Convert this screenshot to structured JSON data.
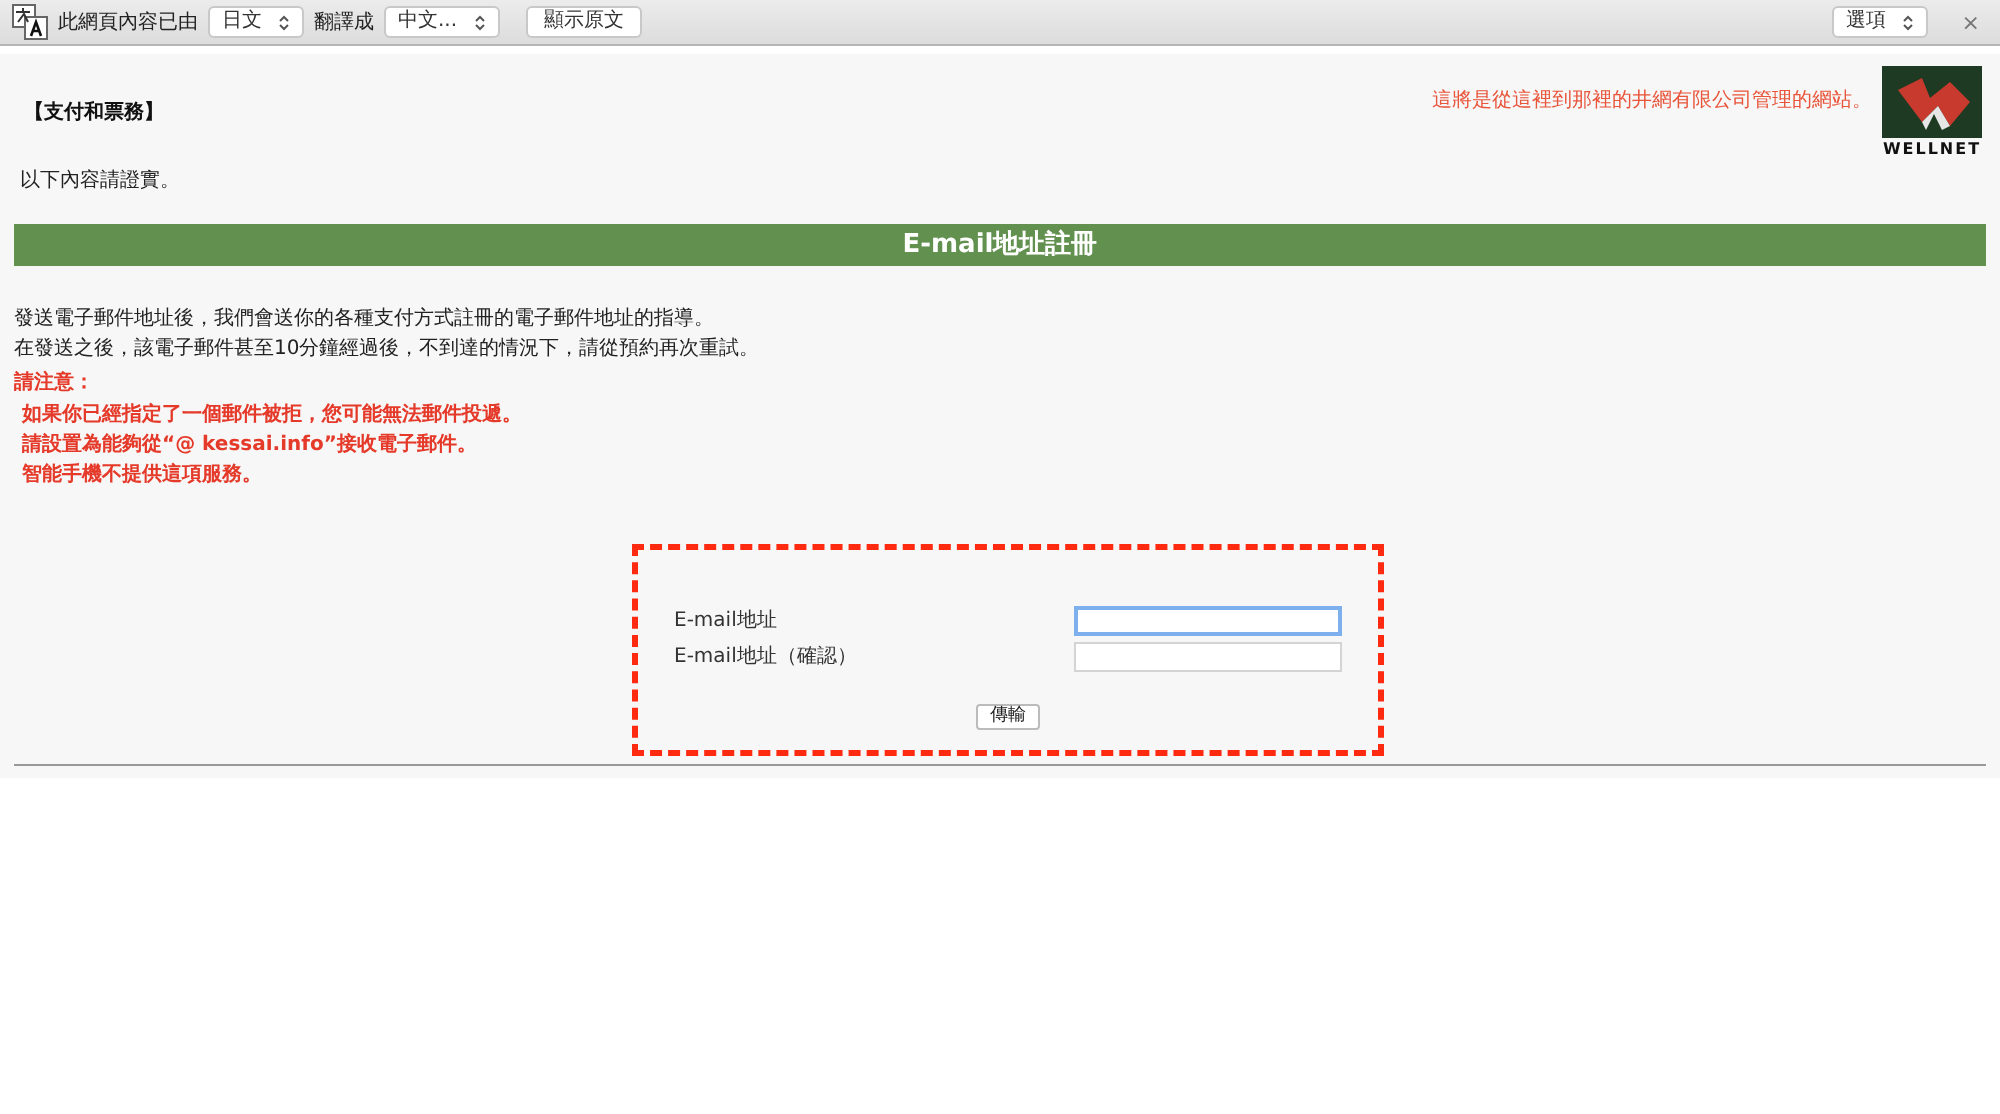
{
  "translate_bar": {
    "message": "此網頁內容已由",
    "source_language": "日文",
    "target_label": "翻譯成",
    "target_language": "中文...",
    "show_original_button": "顯示原文",
    "options_select": "選項",
    "close": "×"
  },
  "header": {
    "section_title": "【支付和票務】",
    "notice": "這將是從這裡到那裡的井網有限公司管理的網站。",
    "logo_text": "WELLNET"
  },
  "intro": "以下內容請證實。",
  "banner_title": "E-mail地址註冊",
  "description": [
    "發送電子郵件地址後，我們會送你的各種支付方式註冊的電子郵件地址的指導。",
    "在發送之後，該電子郵件甚至10分鐘經過後，不到達的情況下，請從預約再次重試。"
  ],
  "caution": {
    "title": "請注意：",
    "items": [
      "如果你已經指定了一個郵件被拒，您可能無法郵件投遞。",
      "請設置為能夠從“@ kessai.info”接收電子郵件。",
      "智能手機不提供這項服務。"
    ]
  },
  "form": {
    "highlighted": true,
    "fields": [
      {
        "label": "E-mail地址",
        "focused": true
      },
      {
        "label": "E-mail地址（確認）",
        "focused": false
      }
    ],
    "submit": "傳輸"
  }
}
